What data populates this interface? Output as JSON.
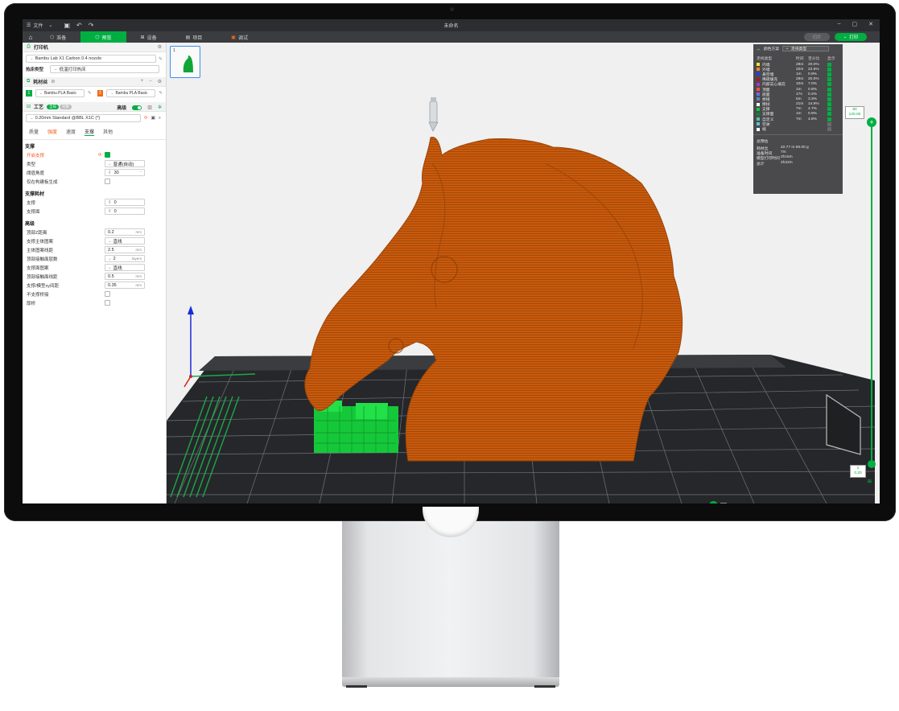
{
  "window": {
    "title": "未命名",
    "menu_label": "文件"
  },
  "tabs": [
    {
      "label": "准备"
    },
    {
      "label": "预览"
    },
    {
      "label": "设备"
    },
    {
      "label": "项目"
    },
    {
      "label": "调试"
    }
  ],
  "actions": {
    "slice": "切片",
    "print": "打印"
  },
  "printer": {
    "section": "打印机",
    "name": "Bambu Lab X1 Carbon 0.4 nozzle",
    "bed_label": "热床类型",
    "bed_value": "低温打印热床"
  },
  "filament": {
    "section": "耗材丝",
    "items": [
      {
        "num": "1",
        "name": "Bambu PLA Basic",
        "color": "#00ae42"
      },
      {
        "num": "2",
        "name": "Bambu PLA Basic",
        "color": "#f16b16"
      }
    ]
  },
  "process": {
    "section": "工艺",
    "badge_global": "全局",
    "badge_object": "对象",
    "advanced_label": "高级",
    "preset": "0.20mm Standard @BBL X1C (*)",
    "subtabs": [
      "质量",
      "强度",
      "速度",
      "支撑",
      "其他"
    ]
  },
  "support": {
    "group": "支撑",
    "enable_label": "开启支撑",
    "type_label": "类型",
    "type_value": "普通(自动)",
    "threshold_label": "阈值角度",
    "threshold_value": "30",
    "on_plate_label": "仅在构建板生成"
  },
  "support_filament": {
    "group": "支撑耗材",
    "support_label": "支撑",
    "support_value": "0",
    "interface_label": "支撑面",
    "interface_value": "0"
  },
  "advanced": {
    "group": "高级",
    "rows": [
      {
        "label": "顶部Z距离",
        "value": "0.2",
        "unit": "mm"
      },
      {
        "label": "支撑主体图案",
        "value": "直线",
        "unit": ""
      },
      {
        "label": "主体图案线距",
        "value": "2.5",
        "unit": "mm"
      },
      {
        "label": "顶部接触面层数",
        "value": "2",
        "unit": "layers"
      },
      {
        "label": "支撑面图案",
        "value": "直线",
        "unit": ""
      },
      {
        "label": "顶部接触面线距",
        "value": "0.5",
        "unit": "mm"
      },
      {
        "label": "支撑/模型xy间距",
        "value": "0.35",
        "unit": "mm"
      }
    ],
    "no_bridge_label": "不支撑桥接",
    "thick_bridge_label": "厚桥"
  },
  "plate": {
    "number": "1"
  },
  "legend": {
    "scheme_label": "颜色方案",
    "scheme_value": "走线类型",
    "col_type": "走线类型",
    "col_time": "时间",
    "col_pct": "百分比",
    "col_show": "显示",
    "rows": [
      {
        "name": "内墙",
        "time": "28m",
        "pct": "20.0%",
        "color": "#ffe620",
        "show": true
      },
      {
        "name": "外墙",
        "time": "32m",
        "pct": "22.5%",
        "color": "#ff7d38",
        "show": true
      },
      {
        "name": "悬空墙",
        "time": "1m",
        "pct": "0.9%",
        "color": "#1f3cff",
        "show": true
      },
      {
        "name": "稀疏填充",
        "time": "28m",
        "pct": "20.0%",
        "color": "#b0162c",
        "show": true
      },
      {
        "name": "内部实心填充",
        "time": "10m",
        "pct": "7.0%",
        "color": "#9c3fc8",
        "show": true
      },
      {
        "name": "顶面",
        "time": "1m",
        "pct": "0.8%",
        "color": "#ff4d4d",
        "show": true
      },
      {
        "name": "底面",
        "time": "17s",
        "pct": "0.2%",
        "color": "#6f6fe0",
        "show": true
      },
      {
        "name": "桥接",
        "time": "5m",
        "pct": "3.3%",
        "color": "#5b87c9",
        "show": true
      },
      {
        "name": "擦拭",
        "time": "21m",
        "pct": "14.9%",
        "color": "#ffffff",
        "show": true
      },
      {
        "name": "支撑",
        "time": "7m",
        "pct": "4.7%",
        "color": "#00d040",
        "show": true
      },
      {
        "name": "支撑面",
        "time": "1m",
        "pct": "0.9%",
        "color": "#10803a",
        "show": true
      },
      {
        "name": "自定义",
        "time": "7m",
        "pct": "4.8%",
        "color": "#59c1a3",
        "show": true
      },
      {
        "name": "空驶",
        "time": "",
        "pct": "",
        "color": "#55c6d8",
        "show": false
      },
      {
        "name": "缩",
        "time": "",
        "pct": "",
        "color": "#ffffff",
        "show": false
      }
    ],
    "estimate_title": "总预估",
    "estimate": [
      {
        "key": "耗材丝",
        "value": "22.77 m   69.00 g"
      },
      {
        "key": "准备时间",
        "value": "7m"
      },
      {
        "key": "模型打印时间",
        "value": "2h15m"
      },
      {
        "key": "总计",
        "value": "2h22m"
      }
    ]
  },
  "layer_slider": {
    "top_layer": "80",
    "top_height": "120.00",
    "bottom_layer": "1",
    "bottom_height": "0.20"
  },
  "move_slider": {
    "value": "0"
  },
  "icons": {
    "menu": "hamburger-icon",
    "save": "save-icon",
    "undo": "undo-icon",
    "redo": "redo-icon",
    "home": "home-icon",
    "settings": "gear-icon",
    "add": "plus-icon",
    "remove": "minus-icon",
    "edit": "edit-icon",
    "layers": "layers-icon",
    "search": "search-icon",
    "reset": "reset-icon"
  }
}
